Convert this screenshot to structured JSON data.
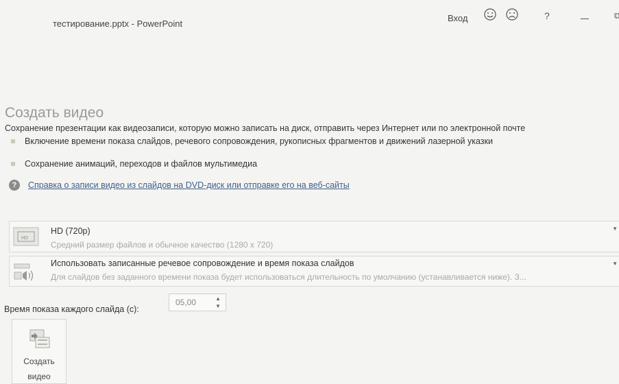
{
  "titlebar": {
    "title": "тестирование.pptx  -  PowerPoint",
    "signin": "Вход",
    "help": "?",
    "restore": "⧉"
  },
  "main": {
    "heading": "Создать видео",
    "description": "Сохранение презентации как видеозаписи, которую можно записать на диск, отправить через Интернет или по электронной почте",
    "bullets": [
      "Включение времени показа слайдов, речевого сопровождения, рукописных фрагментов и движений лазерной указки",
      "Сохранение анимаций, переходов и файлов мультимедиа"
    ],
    "help_link": "Справка о записи видео из слайдов на DVD-диск или отправке его на веб-сайты"
  },
  "quality_dropdown": {
    "title": "HD (720p)",
    "subtitle": "Средний размер файлов и обычное качество (1280 x 720)"
  },
  "narration_dropdown": {
    "title": "Использовать записанные речевое сопровождение и время показа слайдов",
    "subtitle": "Для слайдов без заданного времени показа будет использоваться длительность по умолчанию (устанавливается ниже). З..."
  },
  "timing": {
    "label": "Время показа каждого слайда (с):",
    "value": "05,00"
  },
  "create_button": {
    "line1": "Создать",
    "line2": "видео"
  },
  "icons": {
    "smile": "smile-icon",
    "frown": "frown-icon",
    "help_circle": "help-circle-icon"
  }
}
